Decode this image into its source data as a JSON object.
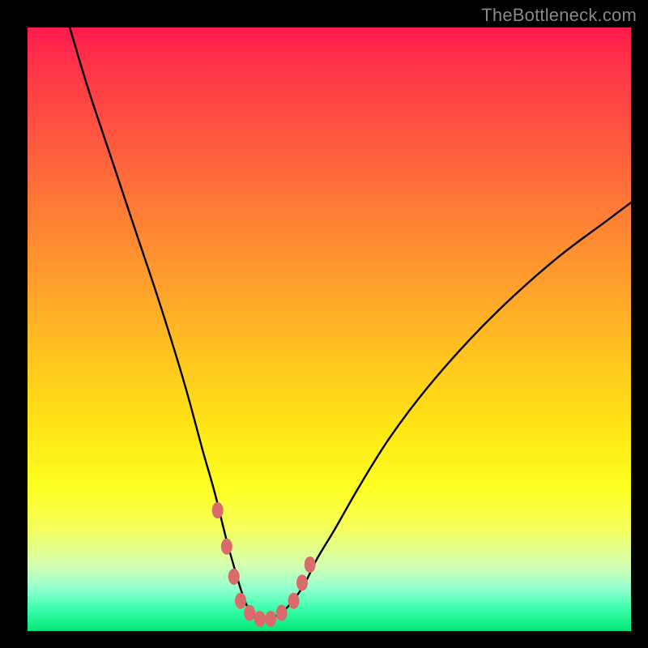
{
  "watermark": "TheBottleneck.com",
  "colors": {
    "frame": "#000000",
    "curve": "#000000",
    "marker": "#d96b6b",
    "gradient_top": "#ff1a4d",
    "gradient_bottom": "#00e878"
  },
  "chart_data": {
    "type": "line",
    "title": "",
    "xlabel": "",
    "ylabel": "",
    "xlim": [
      0,
      100
    ],
    "ylim": [
      0,
      100
    ],
    "series": [
      {
        "name": "bottleneck-curve",
        "x": [
          7,
          10,
          14,
          18,
          22,
          26,
          29,
          31,
          33,
          35,
          36,
          37,
          38,
          39,
          40,
          42,
          44,
          46,
          48,
          51,
          55,
          60,
          66,
          73,
          80,
          88,
          96,
          100
        ],
        "y": [
          100,
          90,
          78,
          66,
          54,
          41,
          30,
          23,
          15,
          8,
          5,
          3,
          2,
          2,
          2,
          3,
          5,
          8,
          12,
          17,
          24,
          32,
          40,
          48,
          55,
          62,
          68,
          71
        ]
      }
    ],
    "markers": {
      "name": "highlight-dots",
      "x": [
        31.5,
        33,
        34.2,
        35.3,
        36.8,
        38.5,
        40.3,
        42.1,
        44.1,
        45.5,
        46.8
      ],
      "y": [
        20,
        14,
        9,
        5,
        3,
        2,
        2,
        3,
        5,
        8,
        11
      ]
    }
  }
}
